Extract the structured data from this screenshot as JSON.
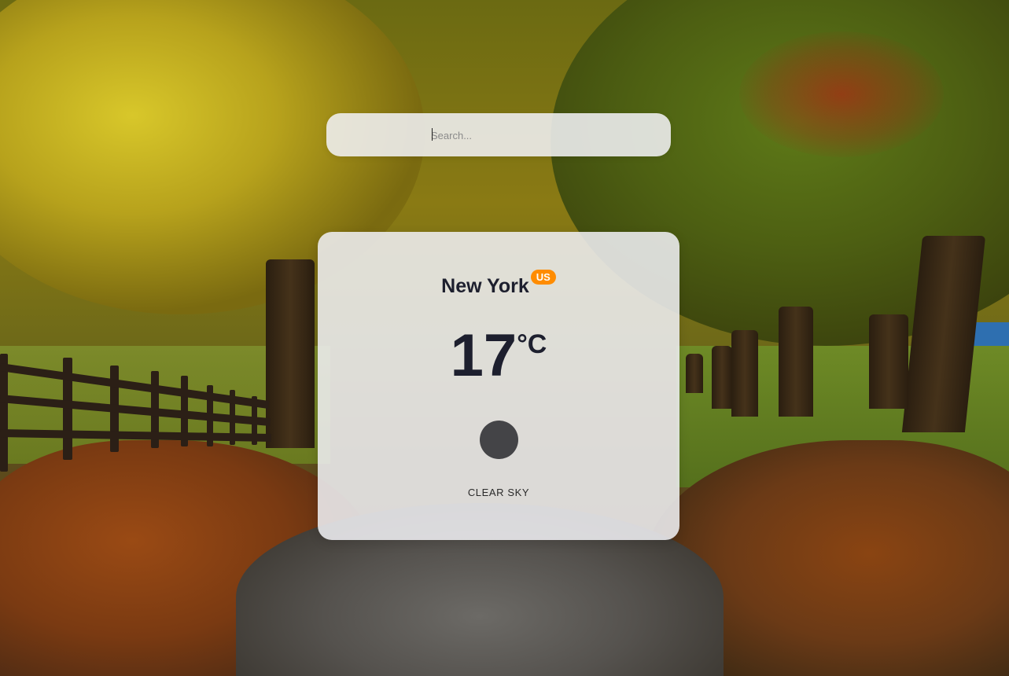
{
  "search": {
    "placeholder": "Search...",
    "value": ""
  },
  "weather": {
    "city": "New York",
    "country": "US",
    "temperature": "17",
    "unit": "°C",
    "description": "CLEAR SKY",
    "icon": "clear-sky-icon"
  },
  "colors": {
    "badge": "#ff8c00",
    "text": "#1d1f2e",
    "icon": "#444447"
  }
}
